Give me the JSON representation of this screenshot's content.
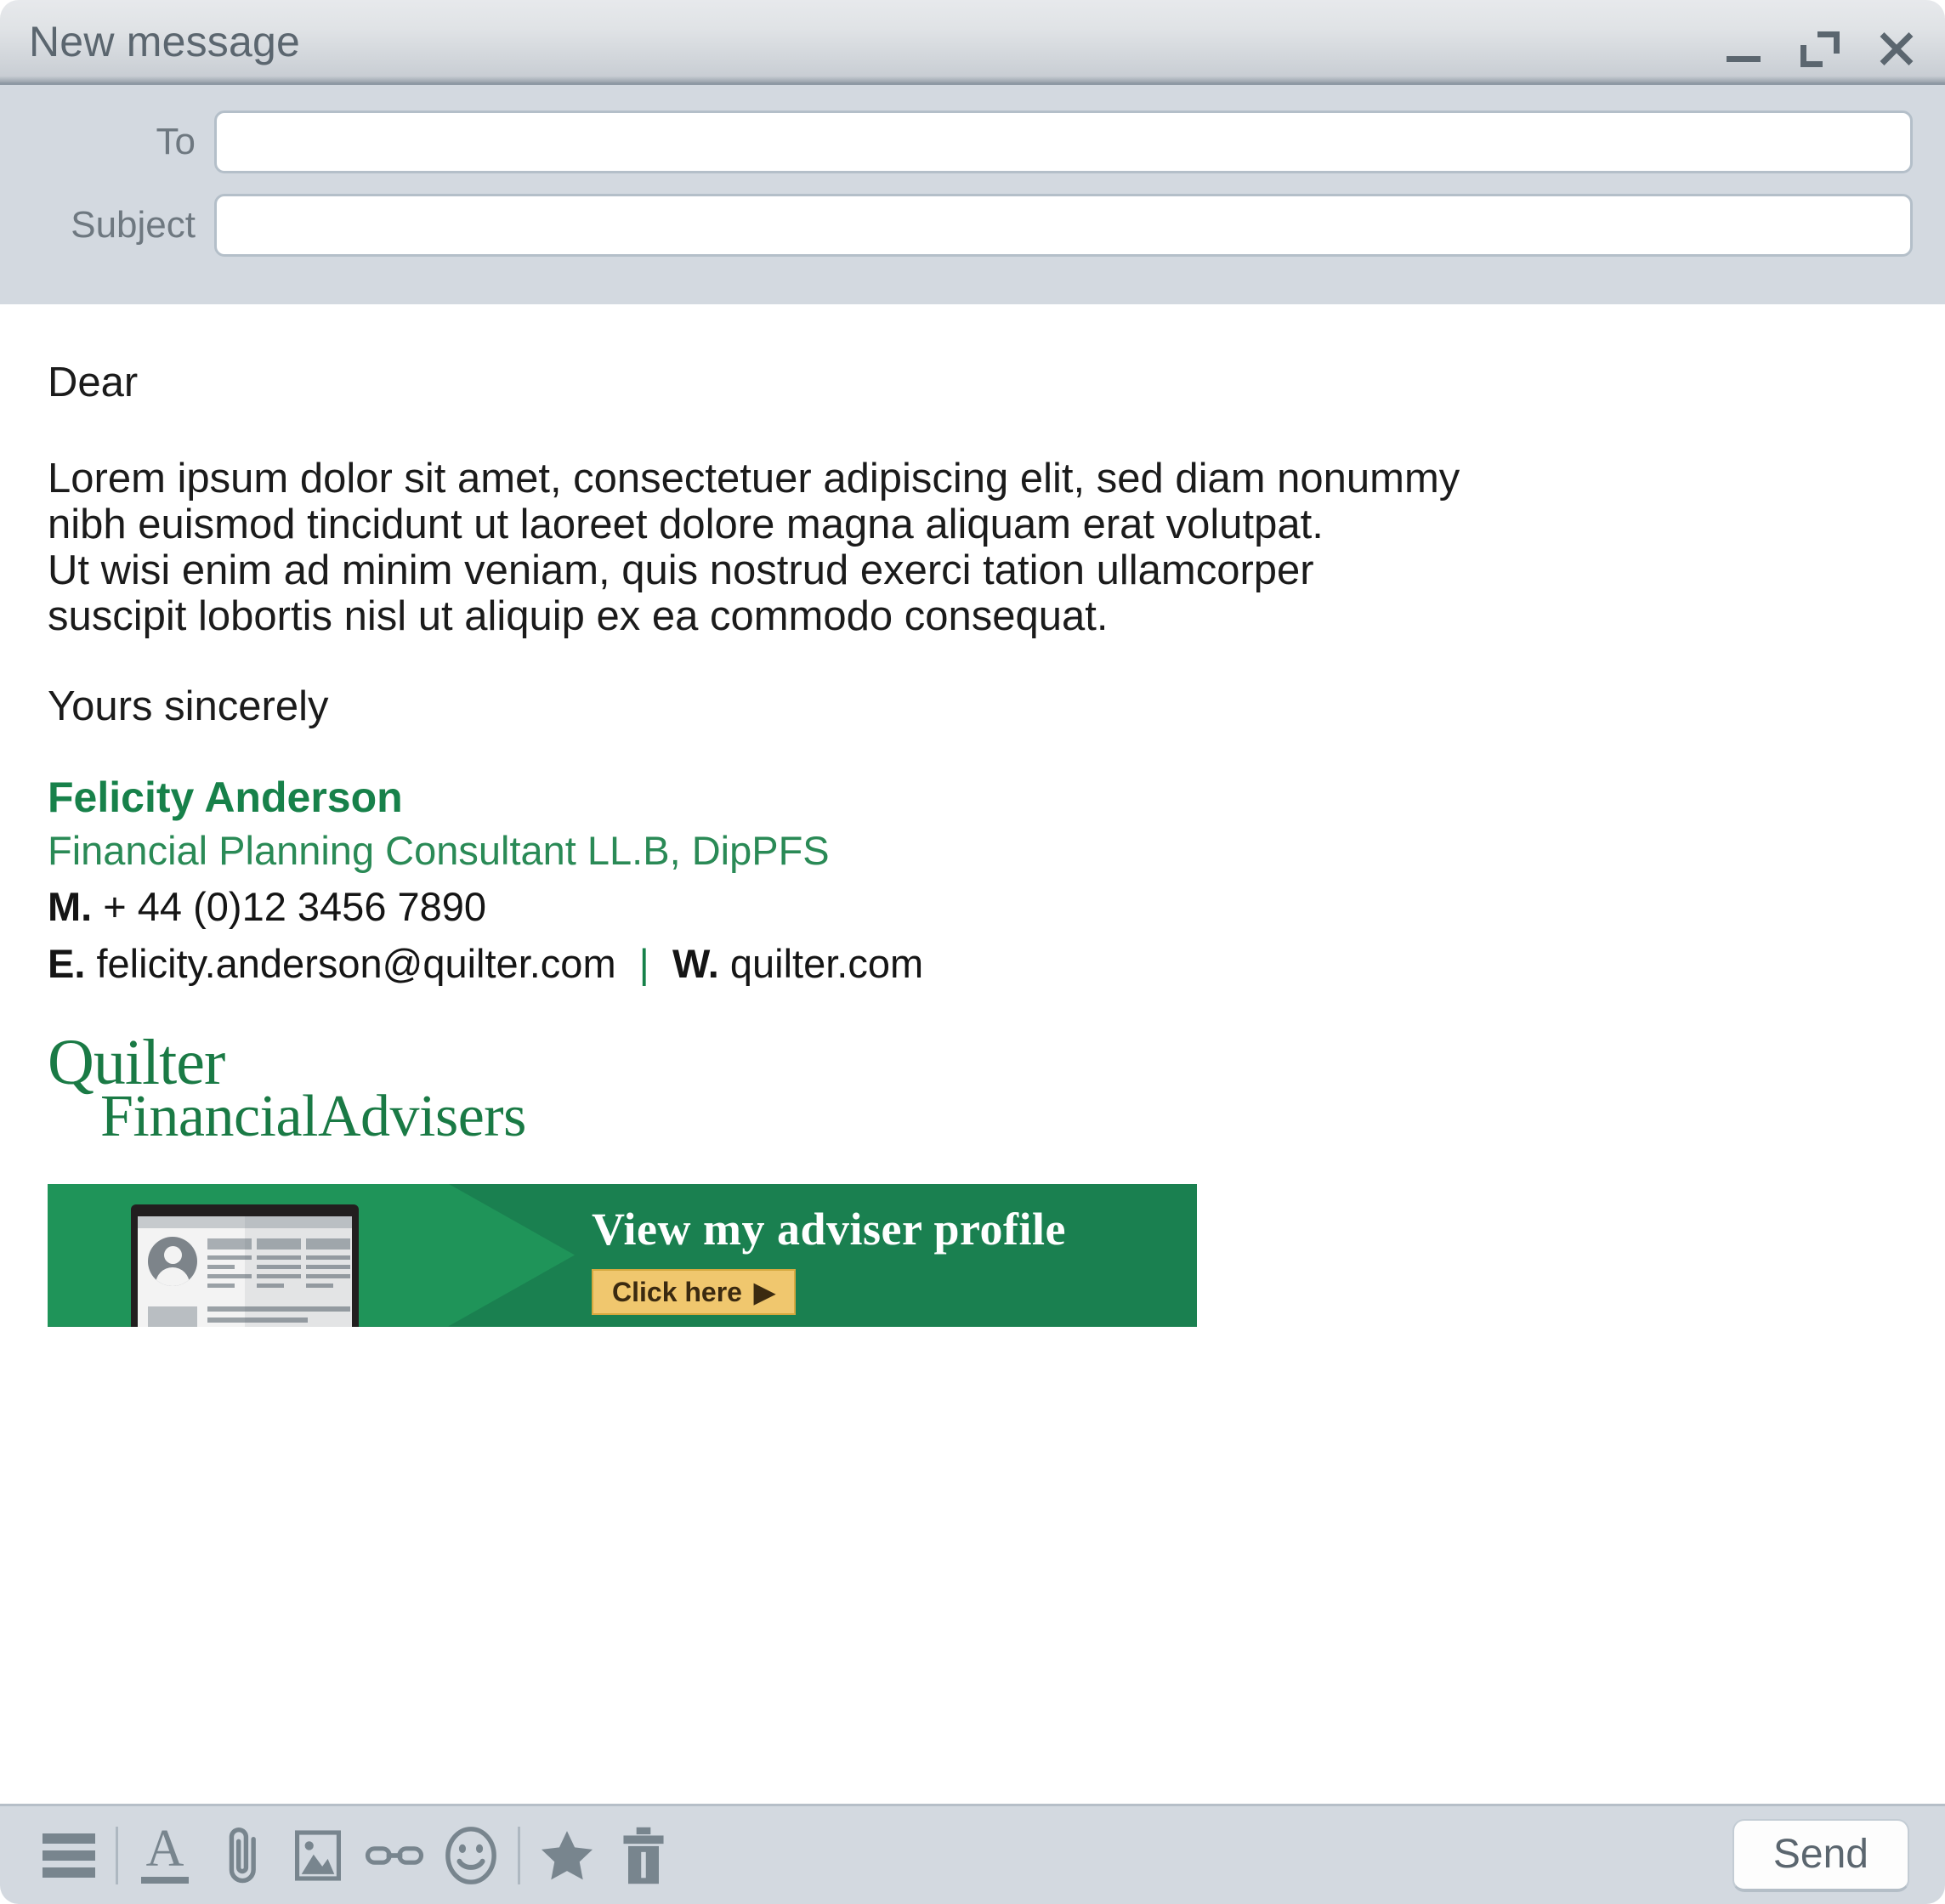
{
  "window": {
    "title": "New message",
    "controls": {
      "minimize": "minimize",
      "maximize": "maximize",
      "close": "close"
    }
  },
  "header": {
    "to_label": "To",
    "to_value": "",
    "to_placeholder": "",
    "subject_label": "Subject",
    "subject_value": "",
    "subject_placeholder": ""
  },
  "body": {
    "greeting": "Dear",
    "paragraph_lines": [
      "Lorem ipsum dolor sit amet, consectetuer adipiscing elit, sed diam nonummy",
      "nibh euismod tincidunt ut laoreet dolore magna aliquam erat volutpat.",
      "Ut wisi enim ad minim veniam, quis nostrud exerci tation ullamcorper",
      "suscipit lobortis nisl ut aliquip ex ea commodo consequat."
    ],
    "closing": "Yours sincerely"
  },
  "signature": {
    "name": "Felicity Anderson",
    "role": "Financial Planning Consultant LL.B, DipPFS",
    "mobile_label": "M.",
    "mobile_value": "+ 44 (0)12 3456 7890",
    "email_label": "E.",
    "email_value": "felicity.anderson@quilter.com",
    "separator": "|",
    "web_label": "W.",
    "web_value": "quilter.com",
    "name_color": "#17814a",
    "role_color": "#2a8a56"
  },
  "logo": {
    "line1": "Quilter",
    "line2": "FinancialAdvisers",
    "color": "#1a7a45"
  },
  "banner": {
    "headline": "View my adviser profile",
    "cta_label": "Click here",
    "cta_arrow": "▶",
    "background_color": "#1a8050",
    "chevron_color": "#1f9459",
    "cta_background": "#f0c76e",
    "cta_text_color": "#3b2a10"
  },
  "toolbar": {
    "icons": [
      {
        "name": "menu-icon",
        "label": "Menu"
      },
      {
        "name": "format-text-icon",
        "label": "Formatting options",
        "glyph": "A"
      },
      {
        "name": "attach-file-icon",
        "label": "Attach file"
      },
      {
        "name": "insert-image-icon",
        "label": "Insert photo"
      },
      {
        "name": "insert-link-icon",
        "label": "Insert link"
      },
      {
        "name": "emoji-icon",
        "label": "Insert emoji"
      },
      {
        "name": "star-icon",
        "label": "Star"
      },
      {
        "name": "trash-icon",
        "label": "Discard draft"
      }
    ],
    "send_label": "Send"
  }
}
